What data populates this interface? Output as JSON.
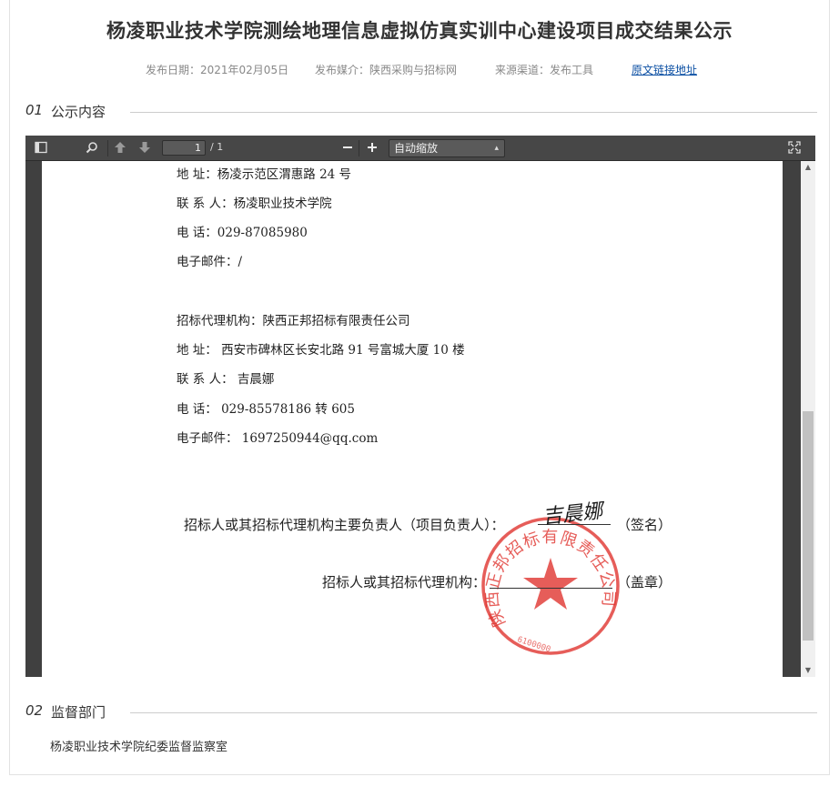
{
  "header": {
    "title": "杨凌职业技术学院测绘地理信息虚拟仿真实训中心建设项目成交结果公示",
    "publish_date": "发布日期：2021年02月05日",
    "publish_media": "发布媒介：陕西采购与招标网",
    "source_channel": "来源渠道：发布工具",
    "original_link": "原文链接地址"
  },
  "section1": {
    "num": "01",
    "label": "公示内容"
  },
  "section2": {
    "num": "02",
    "label": "监督部门",
    "content": "杨凌职业技术学院纪委监督监察室"
  },
  "viewer": {
    "page_current": "1",
    "page_total": "/ 1",
    "zoom_label": "自动缩放",
    "icons": [
      "sidebar-toggle-icon",
      "search-icon",
      "previous-page-icon",
      "next-page-icon",
      "zoom-out-icon",
      "zoom-in-icon",
      "presentation-mode-icon"
    ]
  },
  "document": {
    "buyer": {
      "address": "地    址：杨凌示范区渭惠路 24 号",
      "contact": "联 系 人：杨凌职业技术学院",
      "phone": "电    话：029-87085980",
      "email": "电子邮件：/"
    },
    "agency": {
      "name": "招标代理机构：陕西正邦招标有限责任公司",
      "address": "地    址： 西安市碑林区长安北路 91 号富城大厦 10 楼",
      "contact": "联 系 人： 吉晨娜",
      "phone": "电    话： 029-85578186 转 605",
      "email": "电子邮件： 1697250944@qq.com"
    },
    "signature_line": "招标人或其招标代理机构主要负责人（项目负责人）：",
    "signature_note": "（签名）",
    "signature_text": "吉晨娜",
    "seal_line": "招标人或其招标代理机构：",
    "seal_note": "（盖章）",
    "seal_text": "陕西正邦招标有限责任公司",
    "seal_number": "6100000"
  },
  "colors": {
    "link": "#0b4fa3",
    "seal_red": "#e0342f",
    "viewer_bg": "#404040",
    "toolbar_bg": "#474747"
  }
}
